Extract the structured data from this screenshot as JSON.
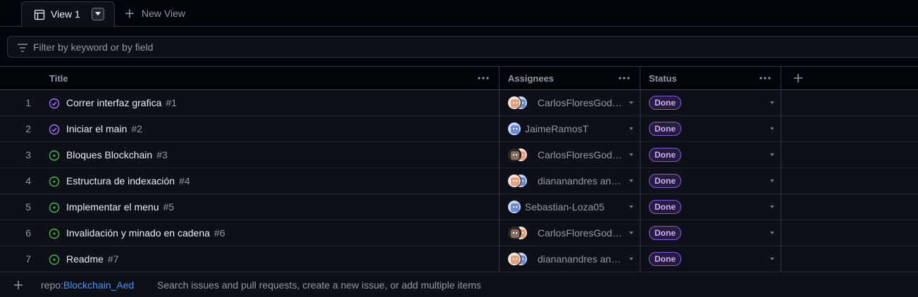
{
  "tabs": {
    "active_label": "View 1",
    "new_view_label": "New View"
  },
  "filter": {
    "placeholder": "Filter by keyword or by field",
    "value": ""
  },
  "columns": {
    "title": "Title",
    "assignees": "Assignees",
    "status": "Status"
  },
  "rows": [
    {
      "index": "1",
      "title": "Correr interfaz grafica",
      "number": "#1",
      "state": "closed",
      "assignees": "CarlosFloresGod…",
      "avatar_count": 2,
      "status": "Done"
    },
    {
      "index": "2",
      "title": "Iniciar el main",
      "number": "#2",
      "state": "closed",
      "assignees": "JaimeRamosT",
      "avatar_count": 1,
      "status": "Done"
    },
    {
      "index": "3",
      "title": "Bloques Blockchain",
      "number": "#3",
      "state": "open",
      "assignees": "CarlosFloresGodo…",
      "avatar_count": 2,
      "status": "Done"
    },
    {
      "index": "4",
      "title": "Estructura de indexación",
      "number": "#4",
      "state": "open",
      "assignees": "diananandres and…",
      "avatar_count": 2,
      "status": "Done"
    },
    {
      "index": "5",
      "title": "Implementar el menu",
      "number": "#5",
      "state": "open",
      "assignees": "Sebastian-Loza05",
      "avatar_count": 1,
      "status": "Done"
    },
    {
      "index": "6",
      "title": "Invalidación y minado en cadena",
      "number": "#6",
      "state": "open",
      "assignees": "CarlosFloresGodo…",
      "avatar_count": 2,
      "status": "Done"
    },
    {
      "index": "7",
      "title": "Readme",
      "number": "#7",
      "state": "open",
      "assignees": "diananandres and…",
      "avatar_count": 2,
      "status": "Done"
    }
  ],
  "footer": {
    "repo_prefix": "repo:",
    "repo_name": "Blockchain_Aed",
    "hint": "Search issues and pull requests, create a new issue, or add multiple items"
  },
  "colors": {
    "closed_icon": "#a371f7",
    "open_icon": "#3fb950",
    "done_badge": "#8957e5",
    "link": "#4493f8"
  },
  "icons": {
    "tab": "table-icon",
    "tab_menu": "triangle-down-icon",
    "new_view": "plus-icon",
    "filter": "filter-icon",
    "column_menu": "kebab-horizontal-icon",
    "add_column": "plus-icon",
    "closed_state": "issue-closed-icon",
    "open_state": "issue-opened-icon"
  }
}
